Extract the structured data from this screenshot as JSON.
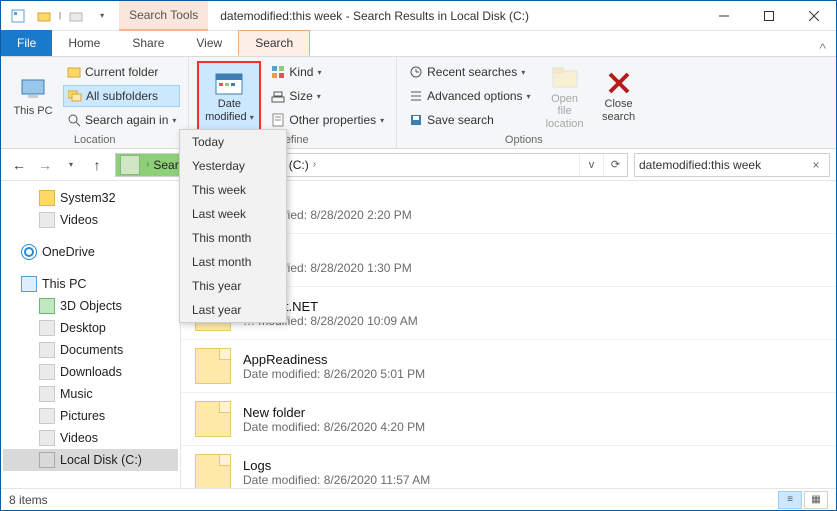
{
  "window": {
    "contextual_tab_label": "Search Tools",
    "title": "datemodified:this week - Search Results in Local Disk (C:)"
  },
  "tabs": {
    "file": "File",
    "home": "Home",
    "share": "Share",
    "view": "View",
    "search": "Search"
  },
  "ribbon": {
    "location": {
      "this_pc": "This PC",
      "current_folder": "Current folder",
      "all_subfolders": "All subfolders",
      "search_again": "Search again in",
      "label": "Location"
    },
    "refine": {
      "date_modified": "Date modified",
      "kind": "Kind",
      "size": "Size",
      "other_properties": "Other properties",
      "label": "Refine"
    },
    "options": {
      "recent_searches": "Recent searches",
      "advanced_options": "Advanced options",
      "save_search": "Save search",
      "open_file_location": "Open file location",
      "close_search": "Close search",
      "label": "Options"
    }
  },
  "date_menu": {
    "items": [
      "Today",
      "Yesterday",
      "This week",
      "Last week",
      "This month",
      "Last month",
      "This year",
      "Last year"
    ]
  },
  "address": {
    "seg_start": "Searc…",
    "seg_disk": "…isk (C:)"
  },
  "search": {
    "value": "datemodified:this week"
  },
  "navpane": {
    "system32": "System32",
    "videos": "Videos",
    "onedrive": "OneDrive",
    "this_pc": "This PC",
    "objects3d": "3D Objects",
    "desktop": "Desktop",
    "documents": "Documents",
    "downloads": "Downloads",
    "music": "Music",
    "pictures": "Pictures",
    "videos2": "Videos",
    "local_disk": "Local Disk (C:)"
  },
  "results": [
    {
      "name": "…p",
      "meta": "… modified: 8/28/2020 2:20 PM"
    },
    {
      "name": "…etch",
      "meta": "… modified: 8/28/2020 1:30 PM"
    },
    {
      "name": "…rosoft.NET",
      "meta": "… modified: 8/28/2020 10:09 AM"
    },
    {
      "name": "AppReadiness",
      "meta": "Date modified: 8/26/2020 5:01 PM"
    },
    {
      "name": "New folder",
      "meta": "Date modified: 8/26/2020 4:20 PM"
    },
    {
      "name": "Logs",
      "meta": "Date modified: 8/26/2020 11:57 AM"
    }
  ],
  "status": {
    "count": "8 items"
  }
}
